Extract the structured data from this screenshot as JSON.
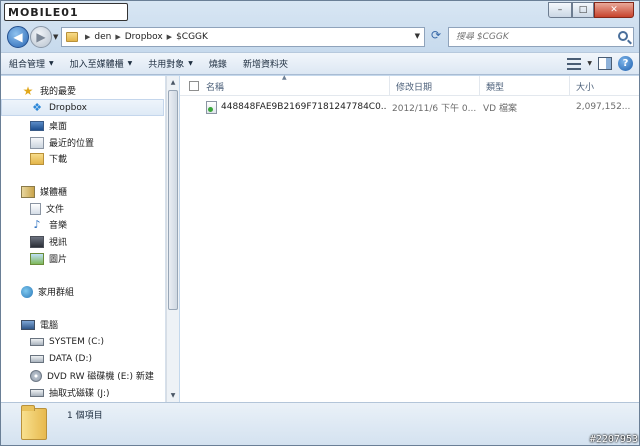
{
  "logo_text": "MOBILE01",
  "window_buttons": {
    "minimize": "–",
    "maximize": "□",
    "close": "✕"
  },
  "nav": {
    "back_glyph": "◀",
    "forward_glyph": "▶",
    "breadcrumb": [
      "den",
      "Dropbox",
      "$CGGK"
    ],
    "refresh_glyph": "⟳",
    "search_placeholder": "搜尋 $CGGK"
  },
  "toolbar": {
    "items": [
      {
        "label": "組合管理",
        "has_menu": true
      },
      {
        "label": "加入至媒體櫃",
        "has_menu": true
      },
      {
        "label": "共用對象",
        "has_menu": true
      },
      {
        "label": "燒錄",
        "has_menu": false
      },
      {
        "label": "新增資料夾",
        "has_menu": false
      }
    ],
    "help_glyph": "?"
  },
  "sidebar": {
    "items": [
      {
        "label": "我的最愛",
        "icon": "star-icon"
      },
      {
        "label": "Dropbox",
        "icon": "dropbox-icon",
        "selected": true
      },
      {
        "label": "桌面",
        "icon": "desktop-icon"
      },
      {
        "label": "最近的位置",
        "icon": "recent-places-icon"
      },
      {
        "label": "下載",
        "icon": "downloads-icon"
      },
      {
        "label": "媒體櫃",
        "icon": "library-icon"
      },
      {
        "label": "文件",
        "icon": "documents-icon"
      },
      {
        "label": "音樂",
        "icon": "music-icon"
      },
      {
        "label": "視訊",
        "icon": "video-icon"
      },
      {
        "label": "圖片",
        "icon": "pictures-icon"
      },
      {
        "label": "家用群組",
        "icon": "homegroup-icon"
      },
      {
        "label": "電腦",
        "icon": "computer-icon"
      },
      {
        "label": "SYSTEM (C:)",
        "icon": "drive-icon"
      },
      {
        "label": "DATA (D:)",
        "icon": "drive-icon"
      },
      {
        "label": "DVD RW 磁碟機 (E:) 新建",
        "icon": "dvd-drive-icon"
      },
      {
        "label": "抽取式磁碟 (J:)",
        "icon": "removable-drive-icon"
      }
    ]
  },
  "file_list": {
    "columns": [
      "名稱",
      "修改日期",
      "類型",
      "大小"
    ],
    "rows": [
      {
        "name": "448848FAE9B2169F7181247784C0...",
        "modified": "2012/11/6 下午 0...",
        "type": "VD 檔案",
        "size": "2,097,152..."
      }
    ]
  },
  "status": {
    "item_count": "1 個項目"
  },
  "watermark": "#2207953"
}
